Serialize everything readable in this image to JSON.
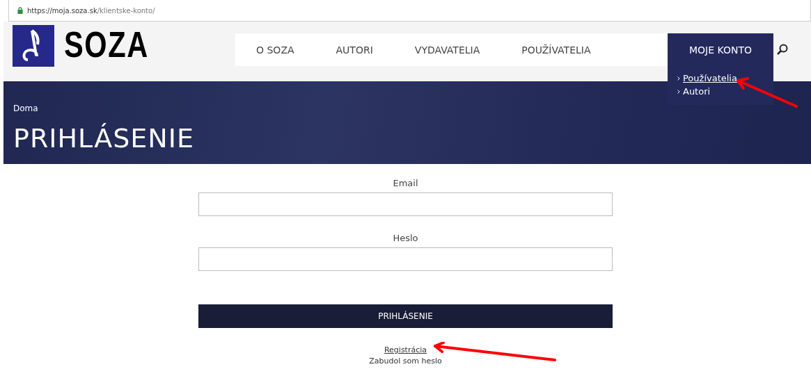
{
  "address_bar": {
    "url_host": "https://moja.soza.sk",
    "url_path": "/klientske-konto/"
  },
  "logo": {
    "text": "SOZA"
  },
  "nav": [
    {
      "label": "O SOZA",
      "selected": false
    },
    {
      "label": "AUTORI",
      "selected": false
    },
    {
      "label": "VYDAVATELIA",
      "selected": false
    },
    {
      "label": "POUŽÍVATELIA",
      "selected": false
    },
    {
      "label": "MOJE KONTO",
      "selected": true,
      "submenu": [
        {
          "label": "Používatelia",
          "selected": true
        },
        {
          "label": "Autori",
          "selected": false
        }
      ]
    }
  ],
  "hero": {
    "breadcrumb": "Doma",
    "title": "PRIHLÁSENIE"
  },
  "form": {
    "fields": [
      {
        "label": "Email"
      },
      {
        "label": "Heslo"
      }
    ],
    "submit": "PRIHLÁSENIE",
    "links": [
      "Registrácia",
      "Zabudol som heslo"
    ]
  }
}
